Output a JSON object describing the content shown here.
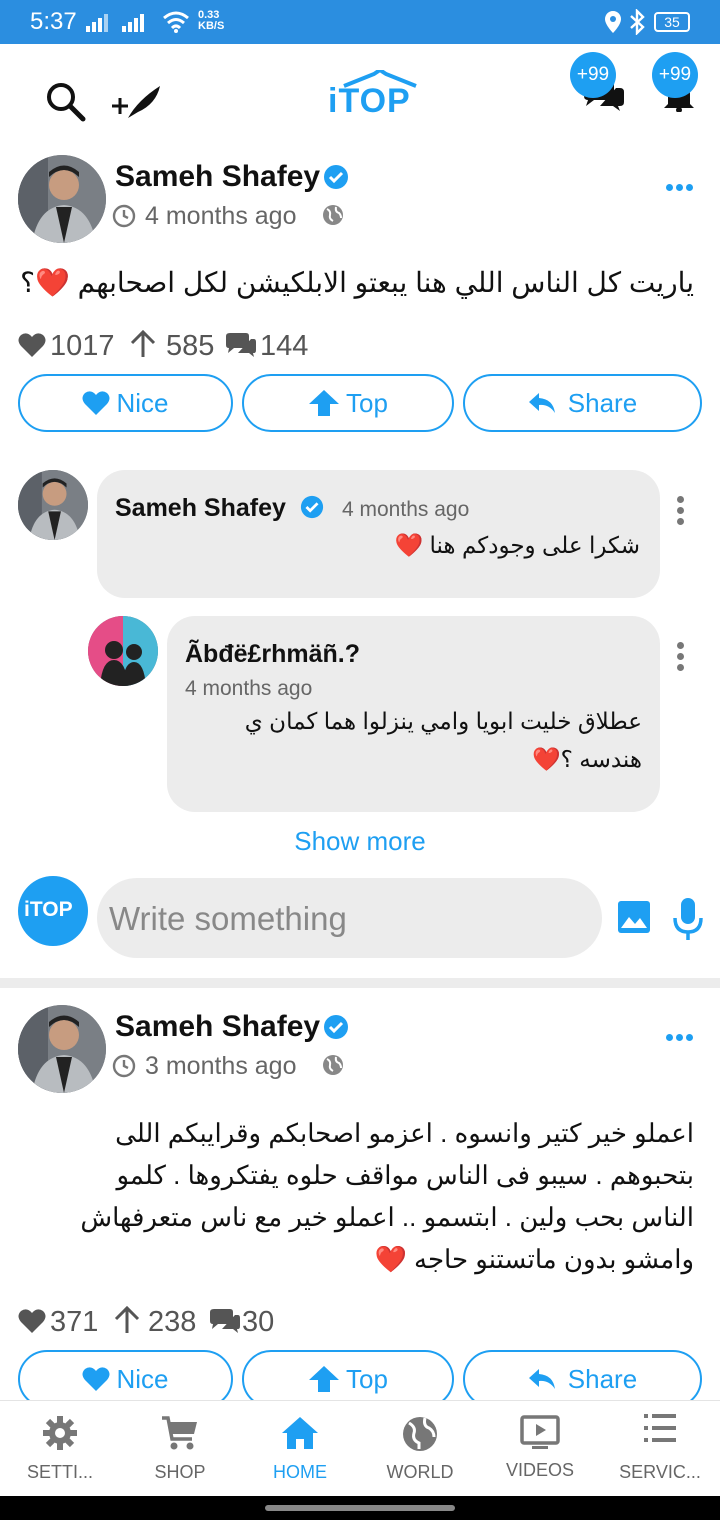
{
  "status_bar": {
    "time": "5:37",
    "speed": "0.33",
    "speed_unit": "KB/S",
    "battery": "35"
  },
  "header": {
    "logo": "iTOP",
    "messages_badge": "+99",
    "notifications_badge": "+99"
  },
  "posts": [
    {
      "author": "Sameh Shafey",
      "time": "4 months ago",
      "text": "ياريت كل الناس اللي هنا يبعتو الابلكيشن لكل اصحابهم ❤️؟",
      "likes": "1017",
      "tops": "585",
      "comments": "144",
      "actions": {
        "nice": "Nice",
        "top": "Top",
        "share": "Share"
      }
    },
    {
      "author": "Sameh Shafey",
      "time": "3 months ago",
      "text_lines": [
        "اعملو خير كتير وانسوه . اعزمو اصحابكم وقرايبكم اللى",
        "بتحبوهم . سيبو فى الناس مواقف حلوه يفتكروها . كلمو",
        "الناس بحب ولين . ابتسمو .. اعملو خير مع ناس متعرفهاش",
        "وامشو بدون ماتستنو حاجه ❤️"
      ],
      "likes": "371",
      "tops": "238",
      "comments": "30",
      "actions": {
        "nice": "Nice",
        "top": "Top",
        "share": "Share"
      }
    }
  ],
  "comments": [
    {
      "author": "Sameh Shafey",
      "time": "4 months ago",
      "text": "شكرا على وجودكم هنا ❤️"
    },
    {
      "author": "Ãbđë£rhmäñ.?",
      "time": "4 months ago",
      "text_lines": [
        "عطلاق خليت ابويا وامي ينزلوا هما كمان ي",
        "هندسه ؟❤️"
      ]
    }
  ],
  "show_more": "Show more",
  "composer": {
    "logo": "iTOP",
    "placeholder": "Write something"
  },
  "bottom_nav": [
    {
      "label": "SETTI...",
      "icon": "gear-icon"
    },
    {
      "label": "SHOP",
      "icon": "cart-icon"
    },
    {
      "label": "HOME",
      "icon": "home-icon",
      "active": true
    },
    {
      "label": "WORLD",
      "icon": "globe-icon"
    },
    {
      "label": "VIDEOS",
      "icon": "video-icon"
    },
    {
      "label": "SERVIC...",
      "icon": "list-icon"
    }
  ],
  "colors": {
    "accent": "#1e9ff2",
    "status_bar": "#2b8ee0",
    "bubble": "#ececec"
  }
}
